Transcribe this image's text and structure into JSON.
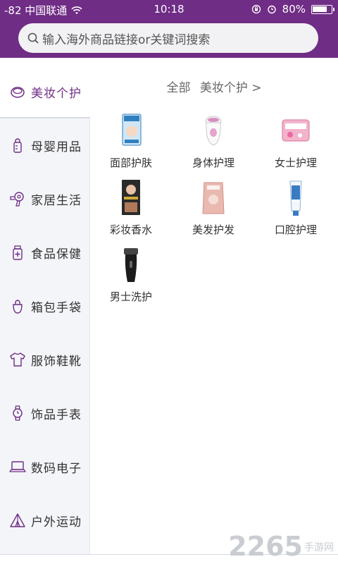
{
  "status_bar": {
    "carrier": "-82 中国联通",
    "time": "10:18",
    "battery": "80%",
    "battery_level": 0.8
  },
  "search": {
    "placeholder": "输入海外商品链接or关键词搜索"
  },
  "sidebar": {
    "items": [
      {
        "label": "美妆个护",
        "icon": "cosmetics-icon",
        "active": true
      },
      {
        "label": "母婴用品",
        "icon": "baby-bottle-icon"
      },
      {
        "label": "家居生活",
        "icon": "hairdryer-icon"
      },
      {
        "label": "食品保健",
        "icon": "medicine-bottle-icon"
      },
      {
        "label": "箱包手袋",
        "icon": "handbag-icon"
      },
      {
        "label": "服饰鞋靴",
        "icon": "tshirt-icon"
      },
      {
        "label": "饰品手表",
        "icon": "watch-icon"
      },
      {
        "label": "数码电子",
        "icon": "laptop-icon"
      },
      {
        "label": "户外运动",
        "icon": "tent-icon"
      }
    ]
  },
  "main": {
    "breadcrumb_all": "全部",
    "breadcrumb_current": "美妆个护",
    "breadcrumb_arrow": ">",
    "categories": [
      {
        "label": "面部护肤",
        "icon": "face-mask-product-icon"
      },
      {
        "label": "身体护理",
        "icon": "epilator-product-icon"
      },
      {
        "label": "女士护理",
        "icon": "pad-pack-product-icon"
      },
      {
        "label": "彩妆香水",
        "icon": "makeup-box-product-icon"
      },
      {
        "label": "美发护发",
        "icon": "hair-care-pouch-icon"
      },
      {
        "label": "口腔护理",
        "icon": "toothpaste-product-icon"
      },
      {
        "label": "男士洗护",
        "icon": "shaver-product-icon"
      }
    ]
  },
  "watermark": {
    "number": "2265",
    "sub": "手游网"
  },
  "colors": {
    "brand": "#6f2d85",
    "sidebar_bg": "#f4f5f8"
  }
}
